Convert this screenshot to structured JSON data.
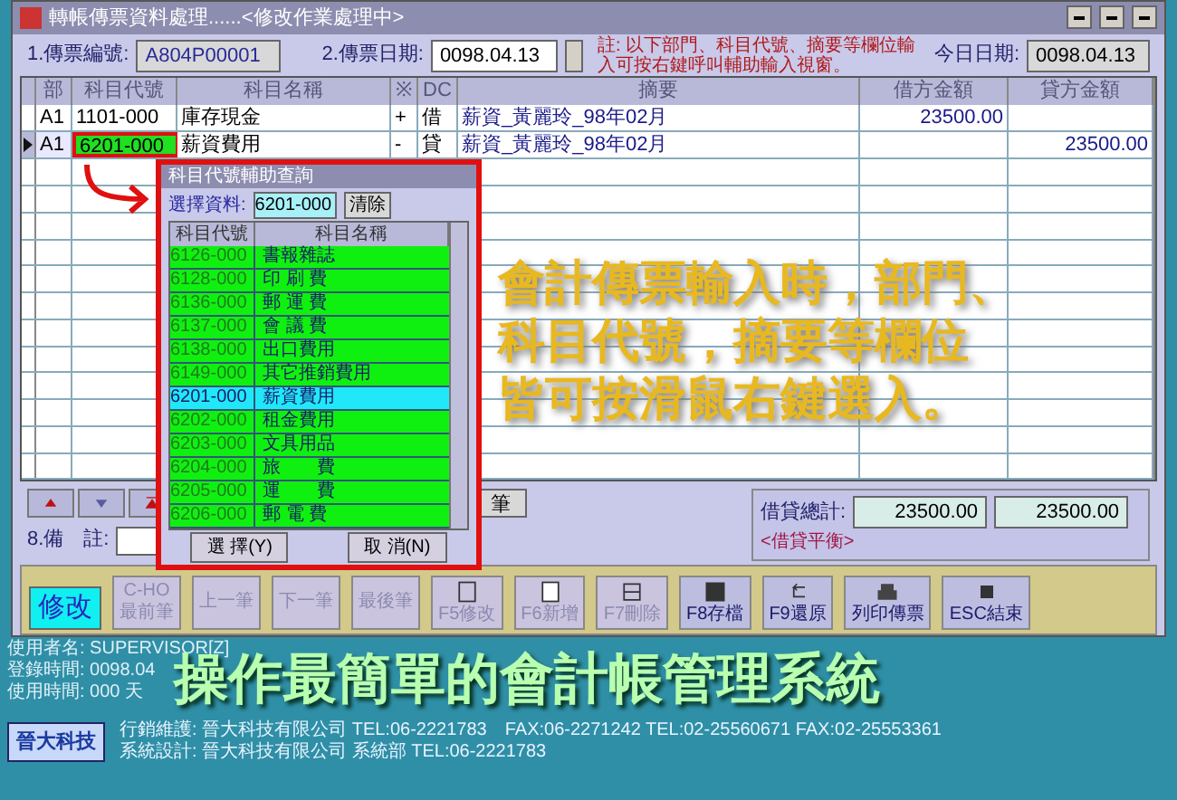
{
  "window": {
    "title": "轉帳傳票資料處理......<修改作業處理中>"
  },
  "header": {
    "voucher_no_label": "1.傳票編號:",
    "voucher_no": "A804P00001",
    "date_label": "2.傳票日期:",
    "date": "0098.04.13",
    "note": "註: 以下部門、科目代號、摘要等欄位輸入可按右鍵呼叫輔助輸入視窗。",
    "today_label": "今日日期:",
    "today": "0098.04.13"
  },
  "grid": {
    "columns": [
      "部",
      "科目代號",
      "科目名稱",
      "※",
      "DC",
      "摘要",
      "借方金額",
      "貸方金額"
    ],
    "rows": [
      {
        "dept": "A1",
        "code": "1101-000",
        "name": "庫存現金",
        "sign": "+",
        "dc": "借",
        "memo": "薪資_黃麗玲_98年02月",
        "debit": "23500.00",
        "credit": "",
        "current": false,
        "highlighted": false
      },
      {
        "dept": "A1",
        "code": "6201-000",
        "name": "薪資費用",
        "sign": "-",
        "dc": "貸",
        "memo": "薪資_黃麗玲_98年02月",
        "debit": "",
        "credit": "23500.00",
        "current": true,
        "highlighted": true
      }
    ]
  },
  "nav": {
    "record_label": "筆",
    "totals_label": "借貸總計:",
    "debit_total": "23500.00",
    "credit_total": "23500.00",
    "balance_status": "<借貸平衡>",
    "remark_label": "8.備　註:"
  },
  "toolbar": {
    "mode": "修改",
    "buttons": [
      {
        "kind": "text",
        "label": "最前筆",
        "top": "C-HO",
        "disabled": true
      },
      {
        "kind": "text",
        "label": "上一筆",
        "disabled": true
      },
      {
        "kind": "text",
        "label": "下一筆",
        "disabled": true
      },
      {
        "kind": "text",
        "label": "最後筆",
        "disabled": true
      },
      {
        "kind": "icon",
        "label": "F5修改",
        "disabled": true
      },
      {
        "kind": "icon",
        "label": "F6新增",
        "disabled": true
      },
      {
        "kind": "icon",
        "label": "F7刪除",
        "disabled": true
      },
      {
        "kind": "icon",
        "label": "F8存檔",
        "disabled": false
      },
      {
        "kind": "icon",
        "label": "F9還原",
        "disabled": false
      },
      {
        "kind": "icon",
        "label": "列印傳票",
        "disabled": false
      },
      {
        "kind": "icon",
        "label": "ESC結束",
        "disabled": false
      }
    ]
  },
  "status": [
    "使用者名: SUPERVISOR[Z]",
    "登錄時間: 0098.04",
    "使用時間: 000 天"
  ],
  "lookup": {
    "title": "科目代號輔助查詢",
    "select_label": "選擇資料:",
    "select_value": "6201-000",
    "clear_button": "清除",
    "columns": [
      "科目代號",
      "科目名稱"
    ],
    "rows": [
      {
        "code": "6126-000",
        "name": "書報雜誌",
        "selected": false
      },
      {
        "code": "6128-000",
        "name": "印 刷 費",
        "selected": false
      },
      {
        "code": "6136-000",
        "name": "郵 運 費",
        "selected": false
      },
      {
        "code": "6137-000",
        "name": "會 議 費",
        "selected": false
      },
      {
        "code": "6138-000",
        "name": "出口費用",
        "selected": false
      },
      {
        "code": "6149-000",
        "name": "其它推銷費用",
        "selected": false
      },
      {
        "code": "6201-000",
        "name": "薪資費用",
        "selected": true
      },
      {
        "code": "6202-000",
        "name": "租金費用",
        "selected": false
      },
      {
        "code": "6203-000",
        "name": "文具用品",
        "selected": false
      },
      {
        "code": "6204-000",
        "name": "旅　　費",
        "selected": false
      },
      {
        "code": "6205-000",
        "name": "運　　費",
        "selected": false
      },
      {
        "code": "6206-000",
        "name": "郵 電 費",
        "selected": false
      }
    ],
    "ok_button": "選 擇(Y)",
    "cancel_button": "取 消(N)"
  },
  "callout": [
    "會計傳票輸入時，部門、",
    "科目代號，摘要等欄位",
    "皆可按滑鼠右鍵選入。"
  ],
  "slogan": "操作最簡單的會計帳管理系統",
  "footer": {
    "logo": "晉大科技",
    "lines": [
      "行銷維護: 晉大科技有限公司 TEL:06-2221783　FAX:06-2271242 TEL:02-25560671 FAX:02-25553361",
      "系統設計: 晉大科技有限公司 系統部 TEL:06-2221783"
    ]
  }
}
